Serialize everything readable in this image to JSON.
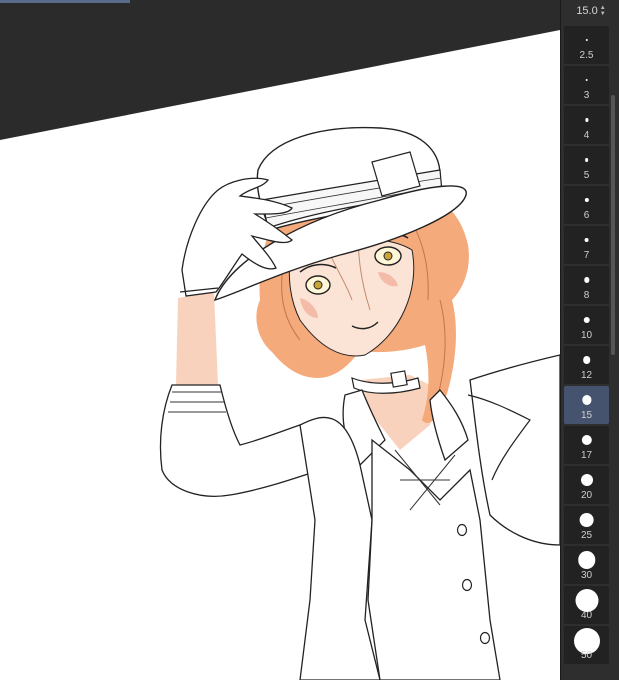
{
  "brush_panel": {
    "current_size": "15.0",
    "sizes": [
      "2.5",
      "3",
      "4",
      "5",
      "6",
      "7",
      "8",
      "10",
      "12",
      "15",
      "17",
      "20",
      "25",
      "30",
      "40",
      "50"
    ],
    "selected_size": "15"
  },
  "colors": {
    "accent_selected": "#45536f",
    "hair": "#f4a574",
    "skin": "#f8d2bc"
  }
}
